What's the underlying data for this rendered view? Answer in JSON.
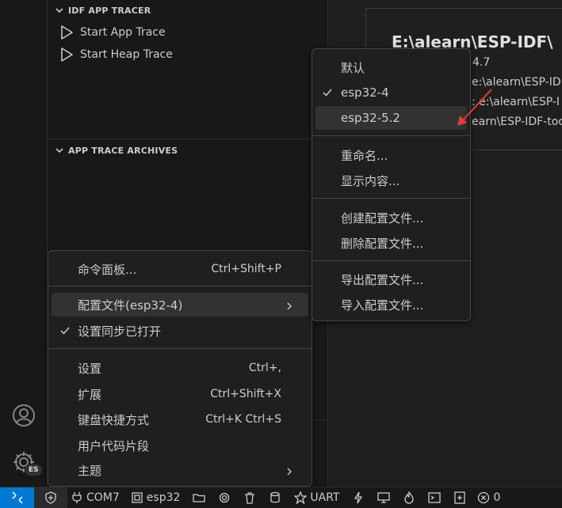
{
  "sidebar": {
    "tracer_section_title": "IDF APP TRACER",
    "tracer_items": [
      {
        "label": "Start App Trace"
      },
      {
        "label": "Start Heap Trace"
      }
    ],
    "archives_section_title": "APP TRACE ARCHIVES"
  },
  "activity_bar": {
    "account_icon": "account-icon",
    "manage_icon": "gear-icon",
    "profile_badge": "ES"
  },
  "editor": {
    "title": "E:\\alearn\\ESP-IDF\\",
    "lines": [
      "4.7",
      "e:\\alearn\\ESP-IDF",
      ": e:\\alearn\\ESP-I",
      "earn\\ESP-IDF-toc"
    ]
  },
  "manage_menu": {
    "items": [
      {
        "label": "命令面板...",
        "accel": "Ctrl+Shift+P"
      },
      {
        "label": "配置文件(esp32-4)",
        "submenu": true
      },
      {
        "label": "设置同步已打开",
        "checked": true
      },
      {
        "label": "设置",
        "accel": "Ctrl+,"
      },
      {
        "label": "扩展",
        "accel": "Ctrl+Shift+X"
      },
      {
        "label": "键盘快捷方式",
        "accel": "Ctrl+K Ctrl+S"
      },
      {
        "label": "用户代码片段"
      },
      {
        "label": "主题",
        "submenu": true
      }
    ]
  },
  "profiles_menu": {
    "items": [
      {
        "label": "默认"
      },
      {
        "label": "esp32-4",
        "checked": true
      },
      {
        "label": "esp32-5.2"
      },
      {
        "label": "重命名..."
      },
      {
        "label": "显示内容..."
      },
      {
        "label": "创建配置文件..."
      },
      {
        "label": "删除配置文件..."
      },
      {
        "label": "导出配置文件..."
      },
      {
        "label": "导入配置文件..."
      }
    ]
  },
  "statusbar": {
    "port": "COM7",
    "target": "esp32",
    "flash_mode": "UART",
    "errors": "0"
  },
  "colors": {
    "remote_bg": "#0078d4",
    "annotation_arrow": "#e53935"
  }
}
